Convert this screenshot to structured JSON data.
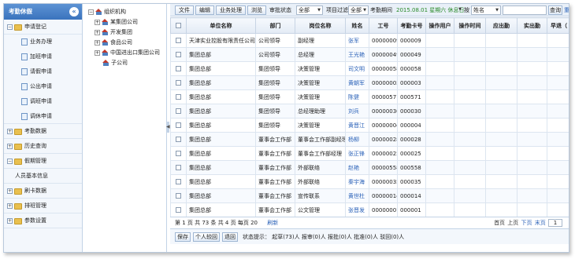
{
  "sidebar": {
    "title": "考勤休假",
    "groups": [
      {
        "label": "申请登记",
        "toggle": "−",
        "children": [
          "业务办理",
          "加班申请",
          "请假申请",
          "公出申请",
          "调班申请",
          "调休申请"
        ]
      },
      {
        "label": "考勤数据",
        "toggle": "+"
      },
      {
        "label": "历史查询",
        "toggle": "+"
      },
      {
        "label": "假期管理",
        "toggle": "−"
      },
      {
        "label": "人员基本信息",
        "plain": true
      },
      {
        "label": "刷卡数据",
        "toggle": "+"
      },
      {
        "label": "排班管理",
        "toggle": "+"
      },
      {
        "label": "参数设置",
        "toggle": "+"
      }
    ]
  },
  "tree": {
    "nodes": [
      "组织机构",
      "某集团公司",
      "开发集团",
      "食品公司",
      "中国进出口集团公司",
      "子公司"
    ],
    "toggles": [
      "−",
      "+",
      "+",
      "+",
      "+"
    ]
  },
  "toolbar": {
    "buttons": [
      "文件",
      "编辑",
      "业务处理",
      "浏览"
    ],
    "audit_label": "审批状态",
    "audit_value": "全部",
    "project_label": "项目过滤",
    "project_value": "全部",
    "date_label": "考勤期间",
    "date_value": "2015.08.01 星期六 休息日",
    "by_label": "按",
    "by_value": "姓名",
    "query_button": "查询",
    "extra_button": "重"
  },
  "table": {
    "headers": [
      "",
      "单位名称",
      "部门",
      "岗位名称",
      "姓名",
      "工号",
      "考勤卡号",
      "操作用户",
      "操作时间",
      "应出勤",
      "实出勤",
      "早退（"
    ],
    "rows": [
      [
        "1",
        "天津实业控股有限责任公司",
        "公司领导",
        "副经理",
        "张军",
        "00000009",
        "000009"
      ],
      [
        "2",
        "集团总部",
        "公司领导",
        "总经理",
        "王光艳",
        "00000049",
        "000049"
      ],
      [
        "3",
        "集团总部",
        "集团领导",
        "决策管理",
        "司文明",
        "00000058",
        "000058"
      ],
      [
        "4",
        "集团总部",
        "集团领导",
        "决策管理",
        "黄朝军",
        "00000003",
        "000003"
      ],
      [
        "5",
        "集团总部",
        "集团领导",
        "决策管理",
        "陈健",
        "00000571",
        "000571"
      ],
      [
        "6",
        "集团总部",
        "集团领导",
        "总经理助理",
        "刘兵",
        "00000030",
        "000030"
      ],
      [
        "7",
        "集团总部",
        "集团领导",
        "决策管理",
        "黄晋江",
        "00000004",
        "000004"
      ],
      [
        "8",
        "集团总部",
        "董事会工作部",
        "董事会工作部副经理",
        "杨柳",
        "00000028",
        "000028"
      ],
      [
        "9",
        "集团总部",
        "董事会工作部",
        "董事会工作部经理",
        "张正锋",
        "00000025",
        "000025"
      ],
      [
        "10",
        "集团总部",
        "董事会工作部",
        "外部联络",
        "赵艳",
        "00000558",
        "000558"
      ],
      [
        "11",
        "集团总部",
        "董事会工作部",
        "外部联络",
        "秦宇海",
        "00000035",
        "000035"
      ],
      [
        "12",
        "集团总部",
        "董事会工作部",
        "宣传联系",
        "黄世杜",
        "00000014",
        "000014"
      ],
      [
        "13",
        "集团总部",
        "董事会工作部",
        "公文管理",
        "张晋发",
        "00000001",
        "000001"
      ]
    ]
  },
  "pager": {
    "summary": "第 1 页 共 73 条 共 4 页 每页",
    "page_size": "20",
    "refresh": "刷新",
    "first": "首页",
    "prev": "上页",
    "next": "下页",
    "last": "末页",
    "pgbox": "1"
  },
  "bottom": {
    "buttons": [
      "保存",
      "个人较回",
      "退回"
    ],
    "status": "状态提示：  起草(73)人  报审(0)人  报批(0)人  批准(0)人  驳回(0)人"
  }
}
